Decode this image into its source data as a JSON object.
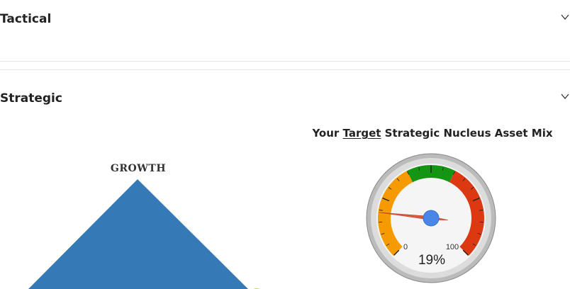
{
  "sections": {
    "tactical": {
      "title": "Tactical"
    },
    "strategic": {
      "title": "Strategic"
    }
  },
  "pyramid": {
    "label_top": "GROWTH",
    "color": "#3579b6"
  },
  "gauge": {
    "title_prefix": "Your ",
    "title_emph": "Target",
    "title_suffix": " Strategic Nucleus Asset Mix",
    "value": 19,
    "value_text": "19%",
    "min_label": "0",
    "max_label": "100",
    "bands": [
      {
        "from": 0,
        "to": 40,
        "color": "#f59a00"
      },
      {
        "from": 40,
        "to": 60,
        "color": "#149614"
      },
      {
        "from": 60,
        "to": 100,
        "color": "#dc3912"
      }
    ],
    "needle_color": "#dc5a3a",
    "hub_color": "#4a86e8"
  }
}
